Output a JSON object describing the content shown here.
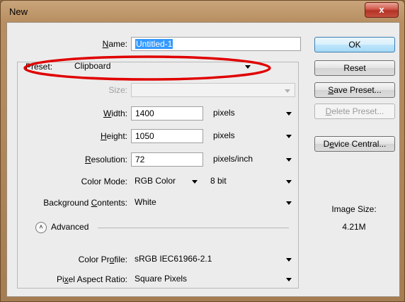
{
  "window": {
    "title": "New",
    "close_symbol": "x"
  },
  "form": {
    "name": {
      "label_pre": "",
      "label_u": "N",
      "label_post": "ame:",
      "value": "Untitled-1"
    },
    "preset": {
      "label_pre": "",
      "label_u": "P",
      "label_post": "reset:",
      "value": "Clipboard"
    },
    "size": {
      "label": "Size:",
      "value": ""
    },
    "width": {
      "label_pre": "",
      "label_u": "W",
      "label_post": "idth:",
      "value": "1400",
      "unit": "pixels"
    },
    "height": {
      "label_pre": "",
      "label_u": "H",
      "label_post": "eight:",
      "value": "1050",
      "unit": "pixels"
    },
    "resolution": {
      "label_pre": "",
      "label_u": "R",
      "label_post": "esolution:",
      "value": "72",
      "unit": "pixels/inch"
    },
    "color_mode": {
      "label": "Color Mode:",
      "value": "RGB Color",
      "depth": "8 bit"
    },
    "background": {
      "label_pre": "Background ",
      "label_u": "C",
      "label_post": "ontents:",
      "value": "White"
    },
    "advanced": {
      "label": "Advanced",
      "icon": "chevron-up-icon"
    },
    "color_profile": {
      "label_pre": "Color Pr",
      "label_u": "o",
      "label_post": "file:",
      "value": "sRGB IEC61966-2.1"
    },
    "pixel_aspect": {
      "label_pre": "Pi",
      "label_u": "x",
      "label_post": "el Aspect Ratio:",
      "value": "Square Pixels"
    }
  },
  "buttons": {
    "ok": "OK",
    "reset": "Reset",
    "save_preset_u": "S",
    "save_preset_rest": "ave Preset...",
    "delete_preset_u": "D",
    "delete_preset_rest": "elete Preset...",
    "device_central_pre": "D",
    "device_central_u": "e",
    "device_central_rest": "vice Central..."
  },
  "image_size": {
    "label": "Image Size:",
    "value": "4.21M"
  },
  "colors": {
    "annotation": "#e00000",
    "selection": "#3399ff"
  }
}
